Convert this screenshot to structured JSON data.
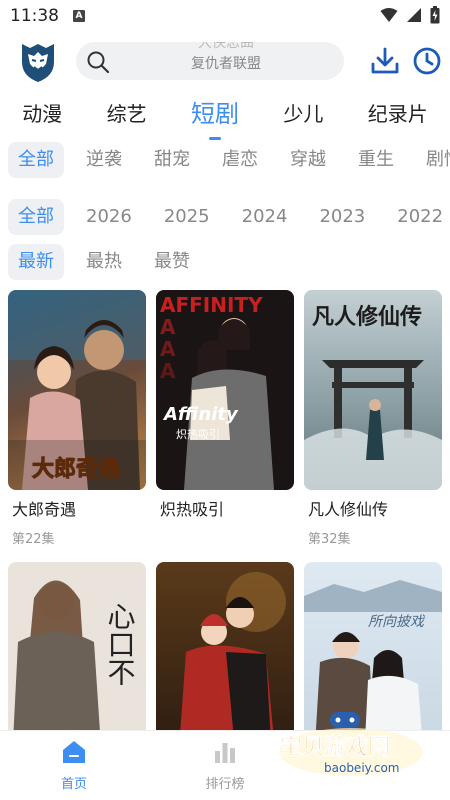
{
  "status": {
    "time": "11:38",
    "notif_letter": "A"
  },
  "search": {
    "prev_text": "大侠恋曲",
    "current_text": "复仇者联盟"
  },
  "categories": [
    "动漫",
    "综艺",
    "短剧",
    "少儿",
    "纪录片"
  ],
  "genres": [
    "全部",
    "逆袭",
    "甜宠",
    "虐恋",
    "穿越",
    "重生",
    "剧情"
  ],
  "years": [
    "全部",
    "2026",
    "2025",
    "2024",
    "2023",
    "2022",
    "20"
  ],
  "sorts": [
    "最新",
    "最热",
    "最赞"
  ],
  "posters": {
    "p2_banner": "AFFINITY",
    "p2_brand": "Affinity",
    "p2_sub": "炽热吸引",
    "p3_title": "凡人修仙传",
    "p1_title": "大郎奇遇",
    "p4_title": "心口不",
    "p6_title": "所向披戏"
  },
  "cards": [
    {
      "title": "大郎奇遇",
      "episodes": "第22集"
    },
    {
      "title": "炽热吸引",
      "episodes": ""
    },
    {
      "title": "凡人修仙传",
      "episodes": "第32集"
    },
    {
      "title": "",
      "episodes": ""
    },
    {
      "title": "",
      "episodes": ""
    },
    {
      "title": "",
      "episodes": ""
    }
  ],
  "nav": {
    "home": "首页",
    "rank": "排行榜"
  },
  "watermark": {
    "title": "宝贝游戏网",
    "url": "baobeiy.com"
  },
  "colors": {
    "accent": "#3d8ef0",
    "chip_bg": "#eef0f3",
    "text_gray": "#888888"
  }
}
